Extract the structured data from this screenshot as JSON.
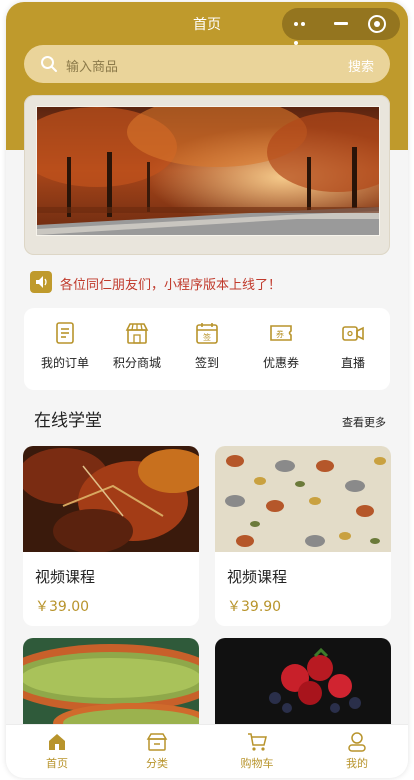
{
  "nav": {
    "title": "首页"
  },
  "search": {
    "placeholder": "输入商品",
    "button": "搜索"
  },
  "notice": {
    "text": "各位同仁朋友们，小程序版本上线了！"
  },
  "menu": {
    "items": [
      {
        "label": "我的订单",
        "icon": "order-icon"
      },
      {
        "label": "积分商城",
        "icon": "shop-icon"
      },
      {
        "label": "签到",
        "icon": "checkin-icon"
      },
      {
        "label": "优惠券",
        "icon": "coupon-icon"
      },
      {
        "label": "直播",
        "icon": "live-icon"
      }
    ]
  },
  "section": {
    "title": "在线学堂",
    "more": "查看更多"
  },
  "courses": [
    {
      "title": "视频课程",
      "price": "￥39.00"
    },
    {
      "title": "视频课程",
      "price": "￥39.90"
    }
  ],
  "tabbar": {
    "items": [
      {
        "label": "首页",
        "icon": "home-icon"
      },
      {
        "label": "分类",
        "icon": "category-icon"
      },
      {
        "label": "购物车",
        "icon": "cart-icon"
      },
      {
        "label": "我的",
        "icon": "profile-icon"
      }
    ]
  },
  "colors": {
    "accent": "#bf9a2c",
    "notice": "#c0392b",
    "price": "#b8942c"
  }
}
